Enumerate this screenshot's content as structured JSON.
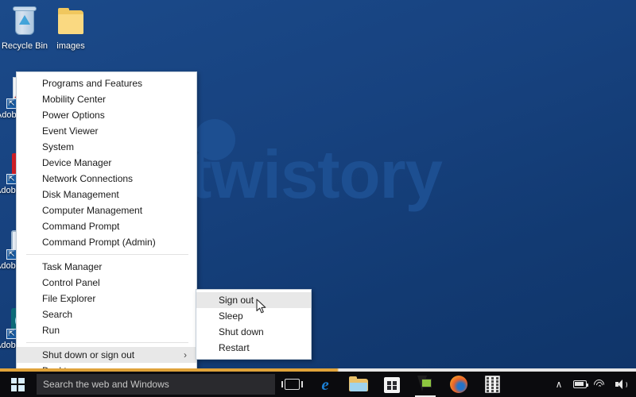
{
  "desktop": {
    "background_color": "#16417c",
    "watermark": {
      "text": "twistory",
      "color": "#1d4f91"
    },
    "icons": [
      {
        "name": "recycle-bin",
        "label": "Recycle Bin",
        "icon": "recycle-bin-icon",
        "shortcut": false
      },
      {
        "name": "images-folder",
        "label": "images",
        "icon": "folder-icon",
        "shortcut": false
      },
      {
        "name": "adobe-acrobat",
        "label": "Adobe Acrobat",
        "icon": "adobe-acrobat-icon",
        "shortcut": true
      },
      {
        "name": "adobe-application-manager",
        "label": "Adobe Application",
        "icon": "adobe-app-icon",
        "shortcut": true
      },
      {
        "name": "adobe-formscentral",
        "label": "Adobe FormsCentral",
        "icon": "adobe-formscentral-icon",
        "shortcut": true
      },
      {
        "name": "adobe-photoshop",
        "label": "Adobe Photoshop",
        "icon": "adobe-photoshop-icon",
        "shortcut": true
      }
    ]
  },
  "winx_menu": {
    "items": [
      {
        "label": "Programs and Features",
        "selected": false,
        "submenu": false
      },
      {
        "label": "Mobility Center",
        "selected": false,
        "submenu": false
      },
      {
        "label": "Power Options",
        "selected": false,
        "submenu": false
      },
      {
        "label": "Event Viewer",
        "selected": false,
        "submenu": false
      },
      {
        "label": "System",
        "selected": false,
        "submenu": false
      },
      {
        "label": "Device Manager",
        "selected": false,
        "submenu": false
      },
      {
        "label": "Network Connections",
        "selected": false,
        "submenu": false
      },
      {
        "label": "Disk Management",
        "selected": false,
        "submenu": false
      },
      {
        "label": "Computer Management",
        "selected": false,
        "submenu": false
      },
      {
        "label": "Command Prompt",
        "selected": false,
        "submenu": false
      },
      {
        "label": "Command Prompt (Admin)",
        "selected": false,
        "submenu": false
      },
      {
        "separator": true
      },
      {
        "label": "Task Manager",
        "selected": false,
        "submenu": false
      },
      {
        "label": "Control Panel",
        "selected": false,
        "submenu": false
      },
      {
        "label": "File Explorer",
        "selected": false,
        "submenu": false
      },
      {
        "label": "Search",
        "selected": false,
        "submenu": false
      },
      {
        "label": "Run",
        "selected": false,
        "submenu": false
      },
      {
        "separator": true
      },
      {
        "label": "Shut down or sign out",
        "selected": true,
        "submenu": true,
        "chevron": "›"
      },
      {
        "label": "Desktop",
        "selected": false,
        "submenu": false
      }
    ]
  },
  "sub_menu": {
    "items": [
      {
        "label": "Sign out",
        "selected": true
      },
      {
        "label": "Sleep",
        "selected": false
      },
      {
        "label": "Shut down",
        "selected": false
      },
      {
        "label": "Restart",
        "selected": false
      }
    ]
  },
  "taskbar": {
    "start_button": {
      "name": "start-button",
      "icon": "windows-logo-icon"
    },
    "search": {
      "placeholder": "Search the web and Windows",
      "value": ""
    },
    "task_view": {
      "label": "Task View",
      "icon": "task-view-icon"
    },
    "apps": [
      {
        "name": "microsoft-edge",
        "icon": "edge-icon",
        "active": false
      },
      {
        "name": "file-explorer",
        "icon": "file-explorer-icon",
        "active": false
      },
      {
        "name": "microsoft-store",
        "icon": "store-icon",
        "active": false
      },
      {
        "name": "green-app",
        "icon": "green-app-icon",
        "active": true
      },
      {
        "name": "mozilla-firefox",
        "icon": "firefox-icon",
        "active": false
      },
      {
        "name": "calculator",
        "icon": "calculator-icon",
        "active": false
      }
    ],
    "tray": [
      {
        "name": "show-hidden-icons",
        "icon": "chevron-up-icon",
        "glyph": "∧"
      },
      {
        "name": "battery",
        "icon": "battery-icon"
      },
      {
        "name": "network",
        "icon": "wifi-icon"
      },
      {
        "name": "volume",
        "icon": "speaker-icon"
      }
    ]
  }
}
